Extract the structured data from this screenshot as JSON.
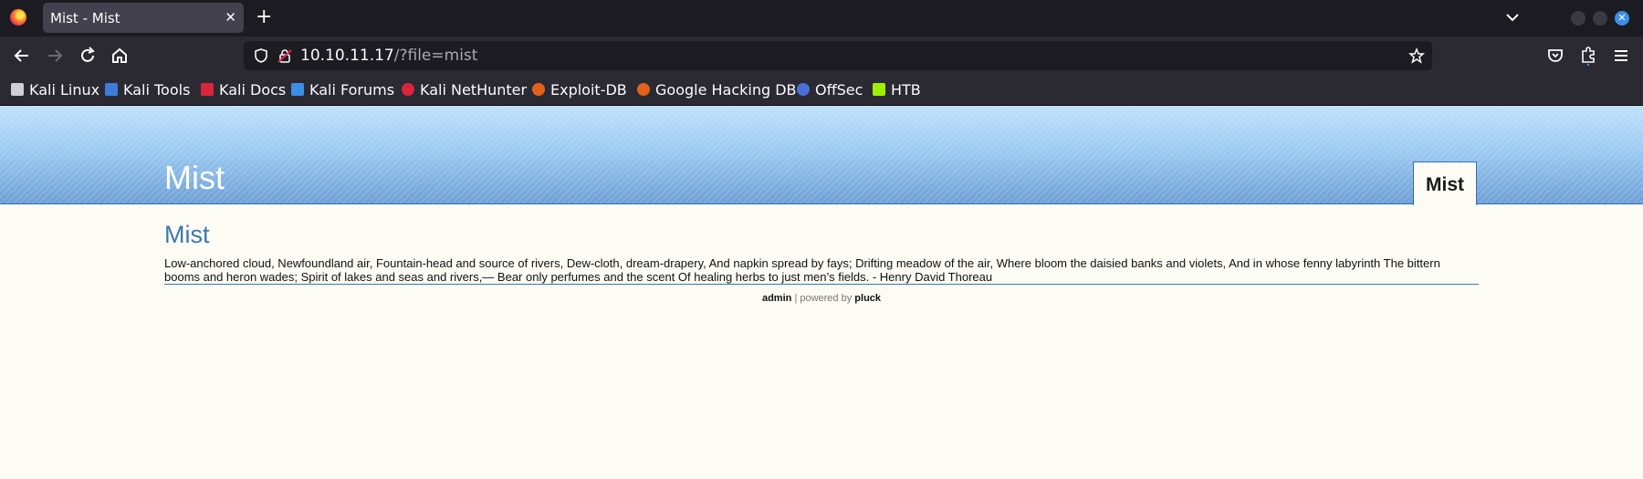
{
  "browser": {
    "tab_title": "Mist - Mist",
    "tab_close_glyph": "✕",
    "new_tab_glyph": "+",
    "url_host": "10.10.11.17",
    "url_path": "/?file=mist",
    "icons": [
      "firefox-logo-icon",
      "back-icon",
      "forward-icon",
      "reload-icon",
      "home-icon",
      "shield-icon",
      "insecure-lock-icon",
      "bookmark-star-icon",
      "pocket-icon",
      "extensions-icon",
      "menu-icon",
      "list-all-tabs-icon"
    ]
  },
  "bookmarks": [
    {
      "label": "Kali Linux",
      "color": "#cfcfd8"
    },
    {
      "label": "Kali Tools",
      "color": "#3d7bd9"
    },
    {
      "label": "Kali Docs",
      "color": "#d9263c"
    },
    {
      "label": "Kali Forums",
      "color": "#3d8fe6"
    },
    {
      "label": "Kali NetHunter",
      "color": "#d9263c"
    },
    {
      "label": "Exploit-DB",
      "color": "#e2621c"
    },
    {
      "label": "Google Hacking DB",
      "color": "#e2621c"
    },
    {
      "label": "OffSec",
      "color": "#4b6fd6"
    },
    {
      "label": "HTB",
      "color": "#9fef00"
    }
  ],
  "site": {
    "title": "Mist",
    "menu_item": "Mist",
    "page_title": "Mist",
    "body": "Low-anchored cloud, Newfoundland air, Fountain-head and source of rivers, Dew-cloth, dream-drapery, And napkin spread by fays; Drifting meadow of the air, Where bloom the daisied banks and violets, And in whose fenny labyrinth The bittern booms and heron wades; Spirit of lakes and seas and rivers,— Bear only perfumes and the scent Of healing herbs to just men’s fields. - Henry David Thoreau",
    "footer_admin": "admin",
    "footer_mid": "| powered by",
    "footer_pluck": "pluck"
  },
  "colors": {
    "accent_blue": "#3c78b0",
    "header_blue": "#8ebbe8",
    "page_bg": "#fcfcf4"
  }
}
